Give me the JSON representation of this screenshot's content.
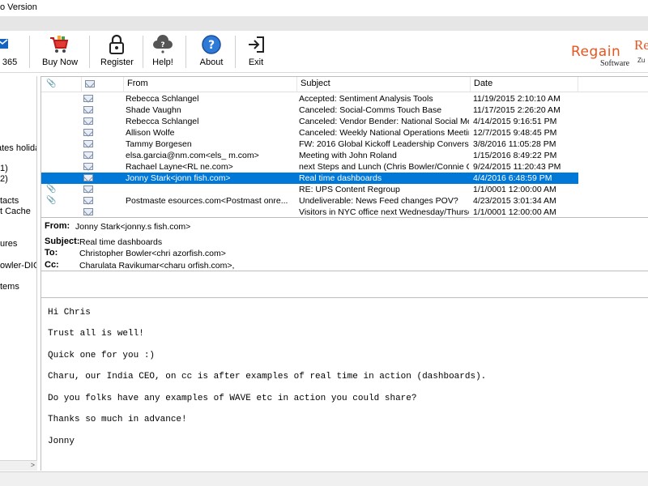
{
  "window": {
    "title_visible": "o Version"
  },
  "toolbar": {
    "items": [
      {
        "label": "t 365",
        "icon": "outlook-icon"
      },
      {
        "label": "Buy Now",
        "icon": "cart-icon"
      },
      {
        "label": "Register",
        "icon": "lock-icon"
      },
      {
        "label": "Help!",
        "icon": "help-cloud-icon"
      },
      {
        "label": "About",
        "icon": "info-icon"
      },
      {
        "label": "Exit",
        "icon": "exit-icon"
      }
    ]
  },
  "brand": {
    "name": "Regain",
    "sub": "Software",
    "name2": "Re",
    "sub2": "Zu"
  },
  "tree": {
    "items": [
      "ates holiday",
      "1)",
      "2)",
      "tacts",
      "t Cache",
      "ures",
      "owler-DIG_",
      "tems"
    ]
  },
  "list": {
    "columns": [
      "From",
      "Subject",
      "Date"
    ],
    "rows": [
      {
        "from": "Rebecca Schlangel",
        "subject": "Accepted: Sentiment Analysis Tools",
        "date": "11/19/2015 2:10:10 AM",
        "attach": false,
        "selected": false
      },
      {
        "from": "Shade Vaughn",
        "subject": "Canceled: Social-Comms Touch Base",
        "date": "11/17/2015 2:26:20 AM",
        "attach": false,
        "selected": false
      },
      {
        "from": "Rebecca Schlangel",
        "subject": "Canceled: Vendor Bender: National Social Media V...",
        "date": "4/14/2015 9:16:51 PM",
        "attach": false,
        "selected": false
      },
      {
        "from": "Allison Wolfe",
        "subject": "Canceled: Weekly National Operations Meeting",
        "date": "12/7/2015 9:48:45 PM",
        "attach": false,
        "selected": false
      },
      {
        "from": "Tammy Borgesen",
        "subject": "FW: 2016 Global Kickoff Leadership Conversation",
        "date": "3/8/2016 11:05:28 PM",
        "attach": false,
        "selected": false
      },
      {
        "from": "elsa.garcia@nm.com<els_            m.com>",
        "subject": "Meeting with John Roland",
        "date": "1/15/2016 8:49:22 PM",
        "attach": false,
        "selected": false
      },
      {
        "from": "Rachael Layne<RL         ne.com>",
        "subject": "next Steps and Lunch (Chris Bowler/Connie Charles)",
        "date": "9/24/2015 11:20:43 PM",
        "attach": false,
        "selected": false
      },
      {
        "from": "Jonny Stark<jonn            fish.com>",
        "subject": "Real time dashboards",
        "date": "4/4/2016 6:48:59 PM",
        "attach": false,
        "selected": true
      },
      {
        "from": "",
        "subject": "RE: UPS Content Regroup",
        "date": "1/1/0001 12:00:00 AM",
        "attach": true,
        "selected": false
      },
      {
        "from": "Postmaste         esources.com<Postmast      onre...",
        "subject": "Undeliverable: News Feed changes POV?",
        "date": "4/23/2015 3:01:34 AM",
        "attach": true,
        "selected": false
      },
      {
        "from": "",
        "subject": "Visitors in NYC office next Wednesday/Thursday",
        "date": "1/1/0001 12:00:00 AM",
        "attach": false,
        "selected": false
      }
    ]
  },
  "header": {
    "from_label": "From:",
    "from": "Jonny Stark<jonny.s         fish.com>",
    "subject_label": "Subject:",
    "subject": "Real time dashboards",
    "to_label": "To:",
    "to": "Christopher Bowler<chri              azorfish.com>",
    "cc_label": "Cc:",
    "cc": "Charulata Ravikumar<charu                     orfish.com>,"
  },
  "body": {
    "lines": [
      "Hi Chris",
      "Trust all is well!",
      "Quick one for you :)",
      "Charu, our India CEO, on cc is after examples of real time in action (dashboards).",
      "Do you folks have any examples of WAVE etc in action you could share?",
      "Thanks so much in advance!",
      "Jonny"
    ]
  },
  "colors": {
    "selection": "#0078d7",
    "brand": "#e8541e",
    "help": "#2d7bd6"
  }
}
